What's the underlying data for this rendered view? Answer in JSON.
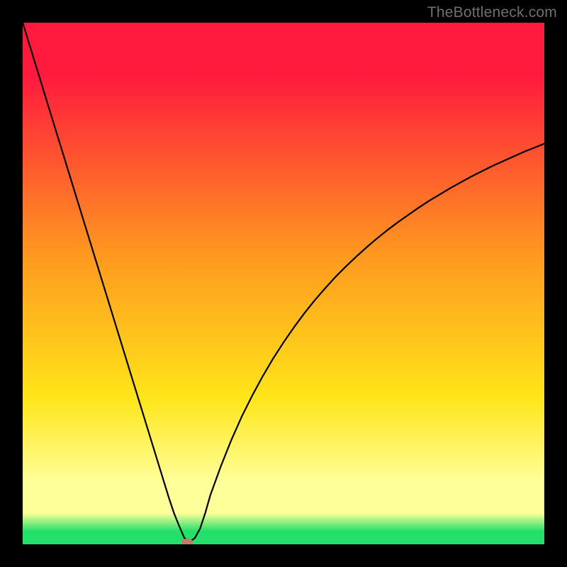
{
  "watermark": "TheBottleneck.com",
  "colors": {
    "red": "#ff1a3e",
    "orange": "#ff9a1f",
    "yellow": "#ffe51a",
    "paleyellow": "#ffff9a",
    "green": "#22e06a",
    "marker": "#c9776b",
    "curve": "#000000"
  },
  "chart_data": {
    "type": "line",
    "title": "",
    "xlabel": "",
    "ylabel": "",
    "xlim": [
      0,
      100
    ],
    "ylim": [
      0,
      100
    ],
    "x": [
      0,
      2,
      4,
      6,
      8,
      10,
      12,
      14,
      16,
      18,
      20,
      22,
      24,
      26,
      28,
      29,
      30,
      31,
      32,
      33,
      34,
      35,
      36,
      38,
      40,
      42,
      44,
      46,
      48,
      50,
      52,
      54,
      56,
      58,
      60,
      62,
      64,
      66,
      68,
      70,
      72,
      74,
      76,
      78,
      80,
      82,
      84,
      86,
      88,
      90,
      92,
      94,
      96,
      98,
      100
    ],
    "y": [
      100,
      93.5,
      87,
      80.5,
      74,
      67.5,
      61,
      54.5,
      48,
      41.5,
      35,
      28.5,
      22,
      15.5,
      9,
      6,
      3.5,
      1.2,
      0.5,
      1.2,
      3,
      6,
      9.5,
      15,
      20,
      24.5,
      28.5,
      32.2,
      35.6,
      38.7,
      41.6,
      44.3,
      46.8,
      49.1,
      51.3,
      53.3,
      55.2,
      57,
      58.7,
      60.3,
      61.8,
      63.2,
      64.6,
      65.9,
      67.1,
      68.3,
      69.4,
      70.5,
      71.5,
      72.5,
      73.4,
      74.3,
      75.2,
      76,
      76.8
    ],
    "marker": {
      "x": 31.5,
      "y": 0.4
    },
    "legend": false,
    "grid": false
  }
}
